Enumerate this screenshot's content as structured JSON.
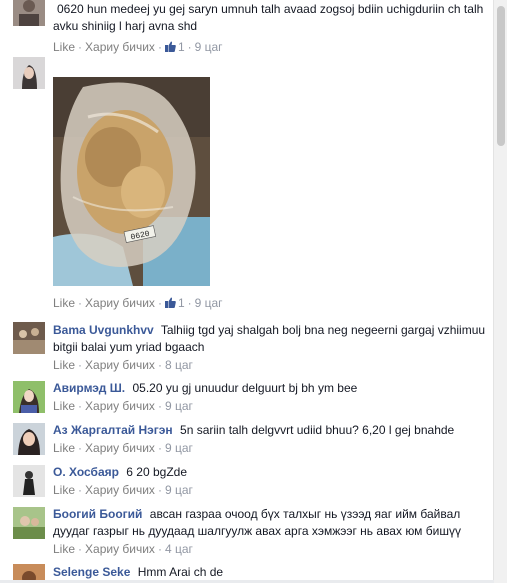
{
  "actions": {
    "like": "Like",
    "reply": "Хариу бичих",
    "sep": "·"
  },
  "comments": [
    {
      "author": "",
      "text": "0620 hun medeej yu gej saryn umnuh talh avaad zogsoj bdiin uchigduriin ch talh avku shiniig l harj avna shd",
      "likes": "1",
      "time": "9 цаг"
    },
    {
      "author": "",
      "text": "",
      "likes": "1",
      "time": "9 цаг",
      "photo_label": "0620"
    },
    {
      "author": "Bama Uvgunkhvv",
      "text": "Talhiig tgd yaj shalgah bolj bna neg negeerni gargaj vzhiimuu bitgii balai yum yriad bgaach",
      "time": "8 цаг"
    },
    {
      "author": "Авирмэд Ш.",
      "text": "05.20 yu gj unuudur delguurt bj bh ym bee",
      "time": "9 цаг"
    },
    {
      "author": "Аз Жаргалтай Нэгэн",
      "text": "5n sariin talh delgvvrt udiid bhuu? 6,20 l gej bnahde",
      "time": "9 цаг"
    },
    {
      "author": "О. Хосбаяр",
      "text": "6 20 bgZde",
      "time": "9 цаг"
    },
    {
      "author": "Боогий Боогий",
      "text": "авсан газраа очоод бүх талхыг нь үзээд яаг ийм байвал дуудаг газрыг нь дуудаад шалгуулж авах арга хэмжээг нь авах юм бишүү",
      "time": "4 цаг"
    },
    {
      "author": "Selenge Seke",
      "text": "Hmm Arai ch de",
      "time": ""
    }
  ]
}
